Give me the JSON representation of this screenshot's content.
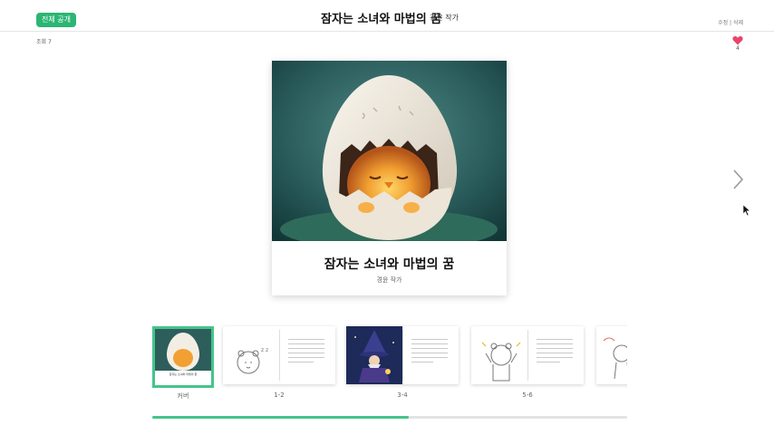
{
  "header": {
    "visibility_badge": "전체 공개",
    "title": "잠자는 소녀와 마법의 꿈",
    "author": "경윤 작가",
    "edit_links": "수정 | 삭제"
  },
  "stats": {
    "views": "조회 7",
    "likes": "4"
  },
  "cover": {
    "title": "잠자는 소녀와 마법의 꿈",
    "author": "경윤 작가"
  },
  "thumbnails": [
    {
      "label": "커버",
      "selected": true,
      "mini_title": "잠자는 소녀와 마법의 꿈"
    },
    {
      "label": "1-2",
      "selected": false
    },
    {
      "label": "3-4",
      "selected": false
    },
    {
      "label": "5-6",
      "selected": false
    },
    {
      "label": "",
      "selected": false
    }
  ],
  "progress": {
    "fraction": 0.54
  },
  "colors": {
    "accent": "#45c48b",
    "badge": "#2bb673",
    "heart": "#e8456b"
  },
  "icons": {
    "next": "chevron-right-icon",
    "like": "heart-icon",
    "cursor": "mouse-cursor-icon"
  }
}
